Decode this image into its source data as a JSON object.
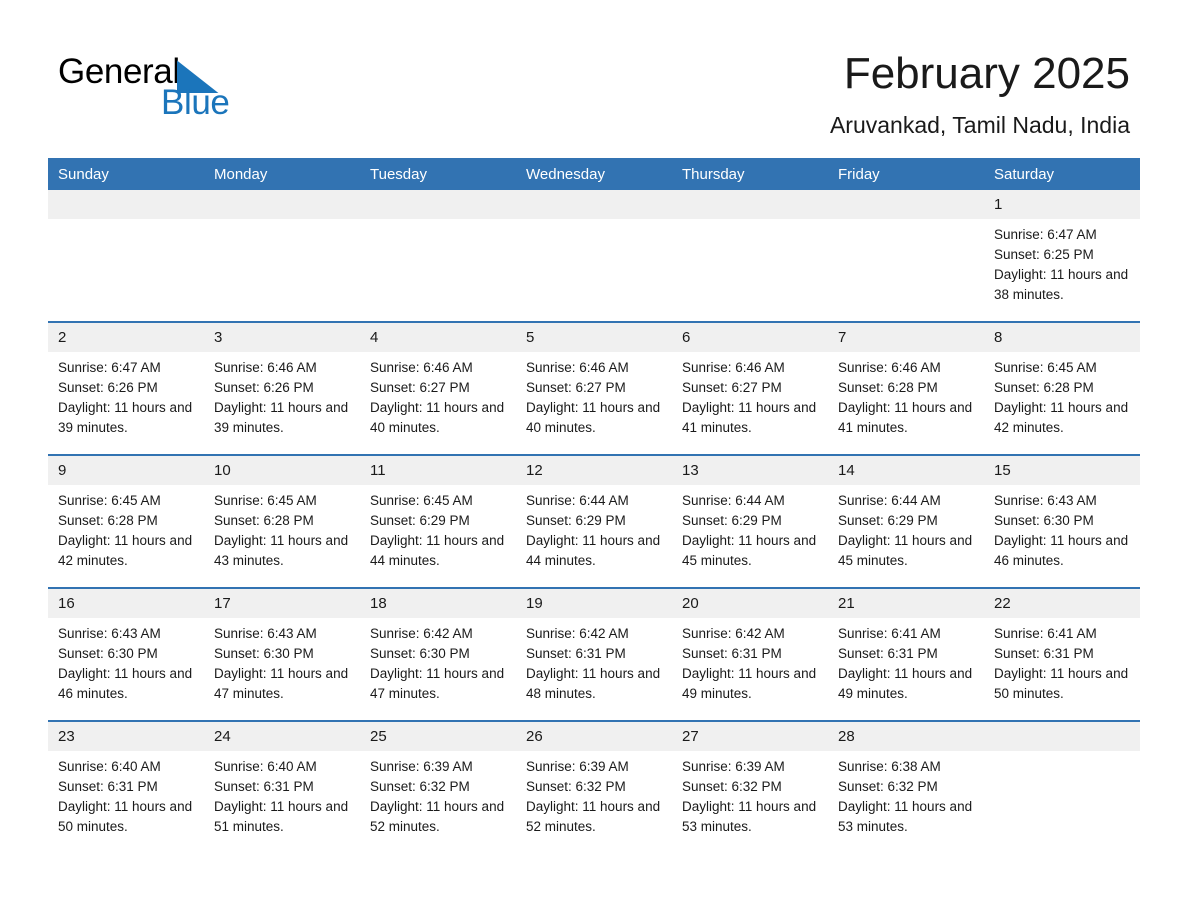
{
  "brand": {
    "name_part1": "General",
    "name_part2": "Blue",
    "triangle_color": "#1b75bb"
  },
  "header": {
    "title": "February 2025",
    "subtitle": "Aruvankad, Tamil Nadu, India"
  },
  "colors": {
    "header_blue": "#3273b2",
    "daynum_band": "#f0f0f0",
    "text": "#1a1a1a",
    "brand_blue": "#1b75bb"
  },
  "calendar": {
    "weekday_headers": [
      "Sunday",
      "Monday",
      "Tuesday",
      "Wednesday",
      "Thursday",
      "Friday",
      "Saturday"
    ],
    "labels": {
      "sunrise_prefix": "Sunrise:",
      "sunset_prefix": "Sunset:",
      "daylight_prefix": "Daylight:"
    },
    "weeks": [
      [
        {
          "blank": true
        },
        {
          "blank": true
        },
        {
          "blank": true
        },
        {
          "blank": true
        },
        {
          "blank": true
        },
        {
          "blank": true
        },
        {
          "day": "1",
          "sunrise": "Sunrise: 6:47 AM",
          "sunset": "Sunset: 6:25 PM",
          "daylight": "Daylight: 11 hours and 38 minutes."
        }
      ],
      [
        {
          "day": "2",
          "sunrise": "Sunrise: 6:47 AM",
          "sunset": "Sunset: 6:26 PM",
          "daylight": "Daylight: 11 hours and 39 minutes."
        },
        {
          "day": "3",
          "sunrise": "Sunrise: 6:46 AM",
          "sunset": "Sunset: 6:26 PM",
          "daylight": "Daylight: 11 hours and 39 minutes."
        },
        {
          "day": "4",
          "sunrise": "Sunrise: 6:46 AM",
          "sunset": "Sunset: 6:27 PM",
          "daylight": "Daylight: 11 hours and 40 minutes."
        },
        {
          "day": "5",
          "sunrise": "Sunrise: 6:46 AM",
          "sunset": "Sunset: 6:27 PM",
          "daylight": "Daylight: 11 hours and 40 minutes."
        },
        {
          "day": "6",
          "sunrise": "Sunrise: 6:46 AM",
          "sunset": "Sunset: 6:27 PM",
          "daylight": "Daylight: 11 hours and 41 minutes."
        },
        {
          "day": "7",
          "sunrise": "Sunrise: 6:46 AM",
          "sunset": "Sunset: 6:28 PM",
          "daylight": "Daylight: 11 hours and 41 minutes."
        },
        {
          "day": "8",
          "sunrise": "Sunrise: 6:45 AM",
          "sunset": "Sunset: 6:28 PM",
          "daylight": "Daylight: 11 hours and 42 minutes."
        }
      ],
      [
        {
          "day": "9",
          "sunrise": "Sunrise: 6:45 AM",
          "sunset": "Sunset: 6:28 PM",
          "daylight": "Daylight: 11 hours and 42 minutes."
        },
        {
          "day": "10",
          "sunrise": "Sunrise: 6:45 AM",
          "sunset": "Sunset: 6:28 PM",
          "daylight": "Daylight: 11 hours and 43 minutes."
        },
        {
          "day": "11",
          "sunrise": "Sunrise: 6:45 AM",
          "sunset": "Sunset: 6:29 PM",
          "daylight": "Daylight: 11 hours and 44 minutes."
        },
        {
          "day": "12",
          "sunrise": "Sunrise: 6:44 AM",
          "sunset": "Sunset: 6:29 PM",
          "daylight": "Daylight: 11 hours and 44 minutes."
        },
        {
          "day": "13",
          "sunrise": "Sunrise: 6:44 AM",
          "sunset": "Sunset: 6:29 PM",
          "daylight": "Daylight: 11 hours and 45 minutes."
        },
        {
          "day": "14",
          "sunrise": "Sunrise: 6:44 AM",
          "sunset": "Sunset: 6:29 PM",
          "daylight": "Daylight: 11 hours and 45 minutes."
        },
        {
          "day": "15",
          "sunrise": "Sunrise: 6:43 AM",
          "sunset": "Sunset: 6:30 PM",
          "daylight": "Daylight: 11 hours and 46 minutes."
        }
      ],
      [
        {
          "day": "16",
          "sunrise": "Sunrise: 6:43 AM",
          "sunset": "Sunset: 6:30 PM",
          "daylight": "Daylight: 11 hours and 46 minutes."
        },
        {
          "day": "17",
          "sunrise": "Sunrise: 6:43 AM",
          "sunset": "Sunset: 6:30 PM",
          "daylight": "Daylight: 11 hours and 47 minutes."
        },
        {
          "day": "18",
          "sunrise": "Sunrise: 6:42 AM",
          "sunset": "Sunset: 6:30 PM",
          "daylight": "Daylight: 11 hours and 47 minutes."
        },
        {
          "day": "19",
          "sunrise": "Sunrise: 6:42 AM",
          "sunset": "Sunset: 6:31 PM",
          "daylight": "Daylight: 11 hours and 48 minutes."
        },
        {
          "day": "20",
          "sunrise": "Sunrise: 6:42 AM",
          "sunset": "Sunset: 6:31 PM",
          "daylight": "Daylight: 11 hours and 49 minutes."
        },
        {
          "day": "21",
          "sunrise": "Sunrise: 6:41 AM",
          "sunset": "Sunset: 6:31 PM",
          "daylight": "Daylight: 11 hours and 49 minutes."
        },
        {
          "day": "22",
          "sunrise": "Sunrise: 6:41 AM",
          "sunset": "Sunset: 6:31 PM",
          "daylight": "Daylight: 11 hours and 50 minutes."
        }
      ],
      [
        {
          "day": "23",
          "sunrise": "Sunrise: 6:40 AM",
          "sunset": "Sunset: 6:31 PM",
          "daylight": "Daylight: 11 hours and 50 minutes."
        },
        {
          "day": "24",
          "sunrise": "Sunrise: 6:40 AM",
          "sunset": "Sunset: 6:31 PM",
          "daylight": "Daylight: 11 hours and 51 minutes."
        },
        {
          "day": "25",
          "sunrise": "Sunrise: 6:39 AM",
          "sunset": "Sunset: 6:32 PM",
          "daylight": "Daylight: 11 hours and 52 minutes."
        },
        {
          "day": "26",
          "sunrise": "Sunrise: 6:39 AM",
          "sunset": "Sunset: 6:32 PM",
          "daylight": "Daylight: 11 hours and 52 minutes."
        },
        {
          "day": "27",
          "sunrise": "Sunrise: 6:39 AM",
          "sunset": "Sunset: 6:32 PM",
          "daylight": "Daylight: 11 hours and 53 minutes."
        },
        {
          "day": "28",
          "sunrise": "Sunrise: 6:38 AM",
          "sunset": "Sunset: 6:32 PM",
          "daylight": "Daylight: 11 hours and 53 minutes."
        },
        {
          "blank": true
        }
      ]
    ]
  }
}
